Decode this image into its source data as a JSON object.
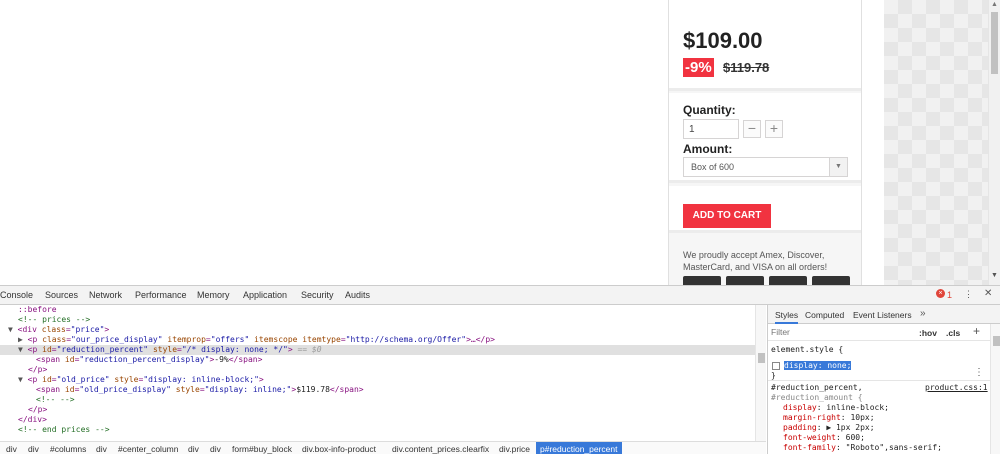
{
  "product": {
    "price": "$109.00",
    "reduction": "-9%",
    "old_price": "$119.78",
    "quantity_label": "Quantity:",
    "quantity_value": "1",
    "minus": "−",
    "plus": "+",
    "amount_label": "Amount:",
    "amount_selected": "Box of 600",
    "add_to_cart": "ADD TO CART",
    "accept_text": "We proudly accept Amex, Discover, MasterCard, and VISA on all orders!"
  },
  "devtools": {
    "tabs": [
      "Console",
      "Sources",
      "Network",
      "Performance",
      "Memory",
      "Application",
      "Security",
      "Audits"
    ],
    "error_count": "1",
    "elements": {
      "l0": "::before",
      "l1": "<!-- prices -->",
      "l2_tag": "<div",
      "l2_attr": "class",
      "l2_val": "\"price\"",
      "l2_end": ">",
      "l3_tag": "<p",
      "l3_a1": "class",
      "l3_v1": "\"our_price_display\"",
      "l3_a2": "itemprop",
      "l3_v2": "\"offers\"",
      "l3_a3": "itemscope itemtype",
      "l3_v3": "\"http://schema.org/Offer\"",
      "l3_end": ">…</p>",
      "l4_tag": "<p",
      "l4_a1": "id",
      "l4_v1": "\"reduction_percent\"",
      "l4_a2": "style",
      "l4_v2": "\"/* display: none; */\"",
      "l4_end": ">",
      "l4_eq": "== $0",
      "l5_tag": "<span",
      "l5_a1": "id",
      "l5_v1": "\"reduction_percent_display\"",
      "l5_text": "-9%",
      "l5_close": "</span>",
      "l6": "</p>",
      "l7_tag": "<p",
      "l7_a1": "id",
      "l7_v1": "\"old_price\"",
      "l7_a2": "style",
      "l7_v2": "\"display: inline-block;\"",
      "l7_end": ">",
      "l8_tag": "<span",
      "l8_a1": "id",
      "l8_v1": "\"old_price_display\"",
      "l8_a2": "style",
      "l8_v2": "\"display: inline;\"",
      "l8_text": "$119.78",
      "l8_close": "</span>",
      "l9": "<!--   -->",
      "l10": "</p>",
      "l11": "</div>",
      "l12": "<!-- end prices -->"
    },
    "breadcrumbs": [
      "div",
      "div",
      "#columns",
      "div",
      "#center_column",
      "div",
      "div",
      "form#buy_block",
      "div.box-info-product",
      "div.content_prices.clearfix",
      "div.price",
      "p#reduction_percent"
    ],
    "styles": {
      "tabs": [
        "Styles",
        "Computed",
        "Event Listeners"
      ],
      "more": "»",
      "filter_placeholder": "Filter",
      "hov": ":hov",
      "cls": ".cls",
      "add": "+",
      "element_style": "element.style {",
      "display_none": "display: none;",
      "close_brace": "}",
      "rule_selector1": "#reduction_percent,",
      "rule_selector2": "#reduction_amount {",
      "source": "product.css:1",
      "props": [
        {
          "name": "display",
          "value": "inline-block;"
        },
        {
          "name": "margin-right",
          "value": "10px;"
        },
        {
          "name": "padding",
          "value": "▶ 1px 2px;"
        },
        {
          "name": "font-weight",
          "value": "600;"
        },
        {
          "name": "font-family",
          "value": "\"Roboto\",sans-serif;"
        }
      ]
    }
  }
}
